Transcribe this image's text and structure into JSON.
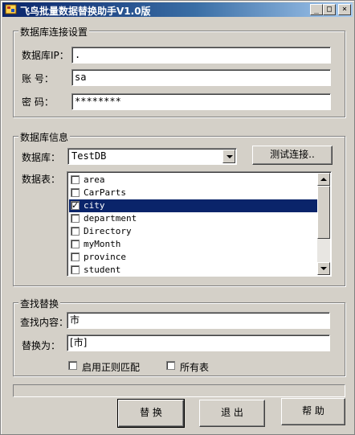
{
  "window": {
    "title": "飞鸟批量数据替换助手V1.0版",
    "controls": {
      "minimize": "_",
      "maximize": "□",
      "close": "×"
    }
  },
  "connection_group": {
    "title": "数据库连接设置",
    "ip_label": "数据库IP：",
    "ip_value": ".",
    "account_label": "账    号：",
    "account_value": "sa",
    "password_label": "密    码：",
    "password_value": "********"
  },
  "db_info_group": {
    "title": "数据库信息",
    "database_label": "数据库：",
    "database_value": "TestDB",
    "test_button": "测试连接..",
    "tables_label": "数据表：",
    "tables": [
      {
        "name": "area",
        "checked": false,
        "selected": false
      },
      {
        "name": "CarParts",
        "checked": false,
        "selected": false
      },
      {
        "name": "city",
        "checked": true,
        "selected": true
      },
      {
        "name": "department",
        "checked": false,
        "selected": false
      },
      {
        "name": "Directory",
        "checked": false,
        "selected": false
      },
      {
        "name": "myMonth",
        "checked": false,
        "selected": false
      },
      {
        "name": "province",
        "checked": false,
        "selected": false
      },
      {
        "name": "student",
        "checked": false,
        "selected": false
      }
    ]
  },
  "replace_group": {
    "title": "查找替换",
    "find_label": "查找内容：",
    "find_value": "市",
    "replace_label": "替换为：",
    "replace_value": "[市]",
    "regex_label": "启用正则匹配",
    "regex_checked": false,
    "all_tables_label": "所有表",
    "all_tables_checked": false
  },
  "progress": {
    "value": 0
  },
  "buttons": {
    "replace": "替 换",
    "exit": "退 出",
    "help": "帮 助"
  },
  "colors": {
    "window_bg": "#d4d0c8",
    "titlebar_start": "#0a246a",
    "titlebar_end": "#a6caf0",
    "selection": "#0a246a"
  }
}
